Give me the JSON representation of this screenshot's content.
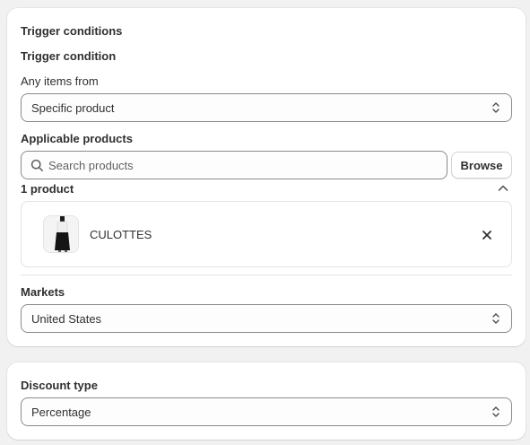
{
  "trigger_card": {
    "title": "Trigger conditions",
    "condition_heading": "Trigger condition",
    "items_label": "Any items from",
    "items_select_value": "Specific product",
    "applicable_heading": "Applicable products",
    "search_placeholder": "Search products",
    "browse_label": "Browse",
    "product_count": "1 product",
    "products": [
      {
        "name": "CULOTTES"
      }
    ],
    "markets_label": "Markets",
    "markets_select_value": "United States"
  },
  "discount_card": {
    "title": "Discount type",
    "select_value": "Percentage"
  },
  "icons": {
    "select": "chevron-updown-icon",
    "search": "search-icon",
    "collapse": "chevron-up-icon",
    "remove": "close-icon"
  },
  "colors": {
    "background": "#f1f1f1",
    "card": "#ffffff",
    "border": "#8a8a8a",
    "text": "#303030",
    "muted": "#616161"
  }
}
